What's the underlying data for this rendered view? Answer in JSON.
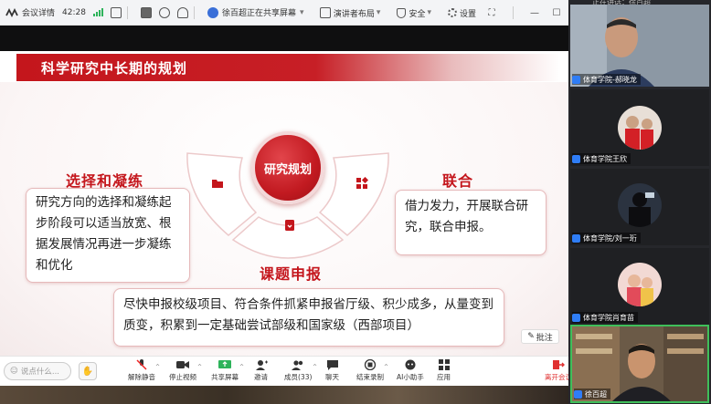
{
  "topbar": {
    "meeting_info": "会议详情",
    "duration": "42:28",
    "sharing_status": "徐百超正在共享屏幕",
    "layout": "演讲者布局",
    "security": "安全",
    "settings": "设置"
  },
  "slide": {
    "title": "科学研究中长期的规划",
    "center": "研究规划",
    "left_heading": "选择和凝练",
    "left_text": "研究方向的选择和凝练起步阶段可以适当放宽、根据发展情况再进一步凝练和优化",
    "right_heading": "联合",
    "right_text": "借力发力，开展联合研究，联合申报。",
    "bottom_heading": "课题申报",
    "bottom_text": "尽快申报校级项目、符合条件抓紧申报省厅级、积少成多，从量变到质变，积累到一定基础尝试部级和国家级（西部项目）",
    "annotate": "批注"
  },
  "toolbar": {
    "chat_placeholder": "说点什么...",
    "unmute": "解除静音",
    "stop_video": "停止视频",
    "share_screen": "共享屏幕",
    "invite": "邀请",
    "members": "成员(33)",
    "chat": "聊天",
    "end_record": "结束录制",
    "ai_assistant": "AI小助手",
    "apps": "应用",
    "leave": "离开会议"
  },
  "gallery": {
    "top_text": "正在讲话：徐百超",
    "participants": [
      {
        "name": "体育学院-郝晓龙"
      },
      {
        "name": "体育学院王欣"
      },
      {
        "name": "体育学院/刘一珩"
      },
      {
        "name": "体育学院肖育苗"
      },
      {
        "name": "徐百超"
      }
    ]
  },
  "colors": {
    "brand_red": "#c4161c",
    "speaker_border": "#3fbf5a",
    "mic_blue": "#2f7df6"
  }
}
